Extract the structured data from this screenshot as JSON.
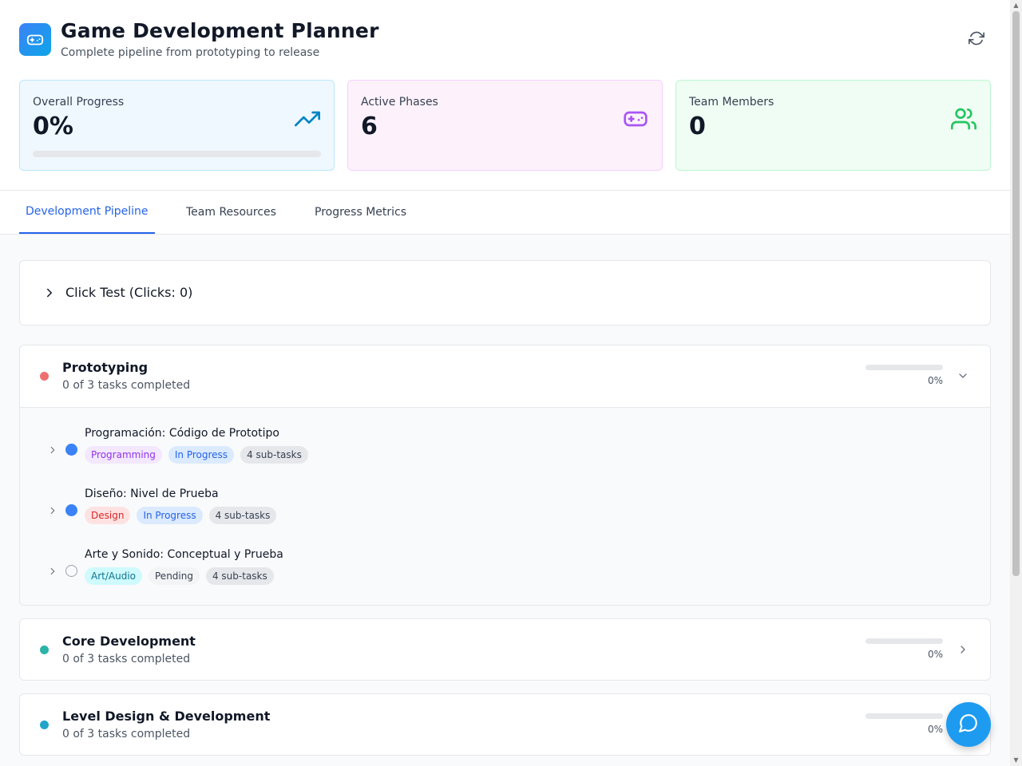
{
  "header": {
    "title": "Game Development Planner",
    "subtitle": "Complete pipeline from prototyping to release",
    "logo_icon": "gamepad-icon",
    "refresh_icon": "refresh-icon",
    "accent": "#1d9bf0"
  },
  "stats": {
    "progress": {
      "label": "Overall Progress",
      "value": "0%",
      "fraction": 0,
      "icon": "trending-up-icon",
      "color": "#0284c7"
    },
    "phases": {
      "label": "Active Phases",
      "value": "6",
      "icon": "gamepad-icon",
      "color": "#a855f7"
    },
    "team": {
      "label": "Team Members",
      "value": "0",
      "icon": "users-icon",
      "color": "#22c55e"
    }
  },
  "tabs": [
    {
      "label": "Development Pipeline",
      "active": true
    },
    {
      "label": "Team Resources",
      "active": false
    },
    {
      "label": "Progress Metrics",
      "active": false
    }
  ],
  "click_test": {
    "label": "Click Test (Clicks: 0)"
  },
  "phases": [
    {
      "title": "Prototyping",
      "subtitle": "0 of 3 tasks completed",
      "percent": "0%",
      "fraction": 0,
      "color": "#ef6f6f",
      "expanded": true,
      "tasks": [
        {
          "name": "Programación: Código de Prototipo",
          "status_icon": "filled-circle-icon",
          "tags": [
            {
              "text": "Programming",
              "kind": "programming"
            },
            {
              "text": "In Progress",
              "kind": "progress"
            },
            {
              "text": "4 sub-tasks",
              "kind": "count"
            }
          ]
        },
        {
          "name": "Diseño: Nivel de Prueba",
          "status_icon": "filled-circle-icon",
          "tags": [
            {
              "text": "Design",
              "kind": "design"
            },
            {
              "text": "In Progress",
              "kind": "progress"
            },
            {
              "text": "4 sub-tasks",
              "kind": "count"
            }
          ]
        },
        {
          "name": "Arte y Sonido: Conceptual y Prueba",
          "status_icon": "empty-circle-icon",
          "tags": [
            {
              "text": "Art/Audio",
              "kind": "art"
            },
            {
              "text": "Pending",
              "kind": "pending"
            },
            {
              "text": "4 sub-tasks",
              "kind": "count"
            }
          ]
        }
      ]
    },
    {
      "title": "Core Development",
      "subtitle": "0 of 3 tasks completed",
      "percent": "0%",
      "fraction": 0,
      "color": "#2bb3a8",
      "expanded": false
    },
    {
      "title": "Level Design & Development",
      "subtitle": "0 of 3 tasks completed",
      "percent": "0%",
      "fraction": 0,
      "color": "#22a5c9",
      "expanded": false
    }
  ],
  "fab": {
    "icon": "chat-bubble-icon"
  }
}
